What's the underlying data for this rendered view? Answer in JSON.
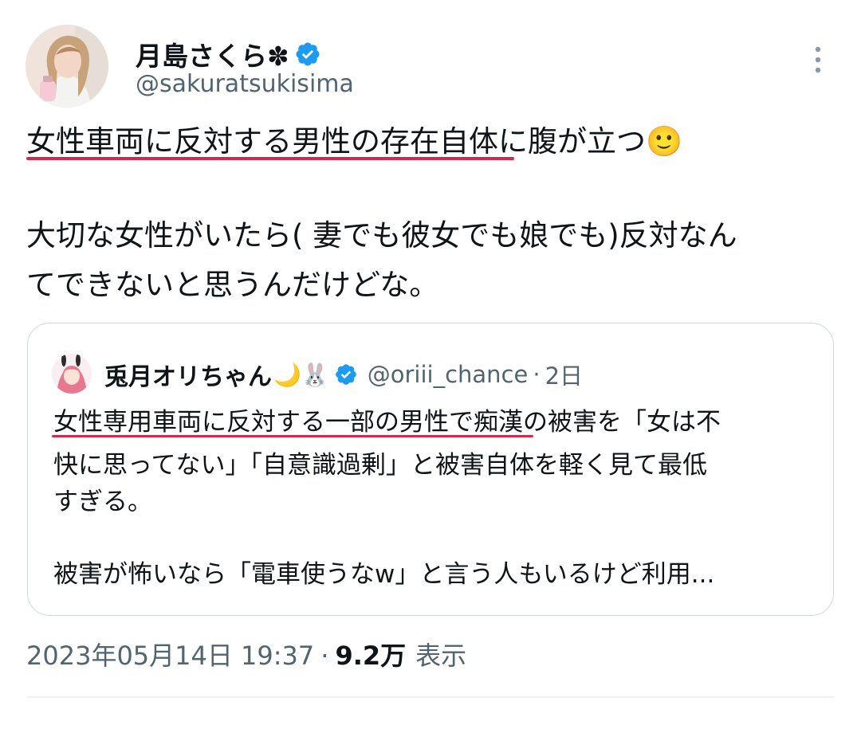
{
  "author": {
    "display_name": "月島さくら✽",
    "handle": "@sakuratsukisima"
  },
  "tweet": {
    "line1": "女性車両に反対する男性の存在自体に腹が立つ🙂",
    "line2": "大切な女性がいたら( 妻でも彼女でも娘でも)反対なん",
    "line3": "てできないと思うんだけどな。",
    "timestamp": "2023年05月14日 19:37",
    "separator": "·",
    "views_count": "9.2万",
    "views_label": "表示"
  },
  "quoted_tweet": {
    "display_name": "兎月オリちゃん",
    "name_emoji": "🌙🐰",
    "handle": "@oriii_chance",
    "dot": "·",
    "time": "2日",
    "line1": "女性専用車両に反対する一部の男性で痴漢の被害を「女は不",
    "line2": "快に思ってない」「自意識過剰」と被害自体を軽く見て最低",
    "line3": "すぎる。",
    "line4": "被害が怖いなら「電車使うなw」と言う人もいるけど利用..."
  },
  "colors": {
    "verified": "#1d9bf0",
    "underline": "#d42a4a",
    "secondary_text": "#536471",
    "border": "#cfd9de"
  },
  "icons": {
    "verified": "verified-badge-icon",
    "more": "more-vertical-icon"
  }
}
